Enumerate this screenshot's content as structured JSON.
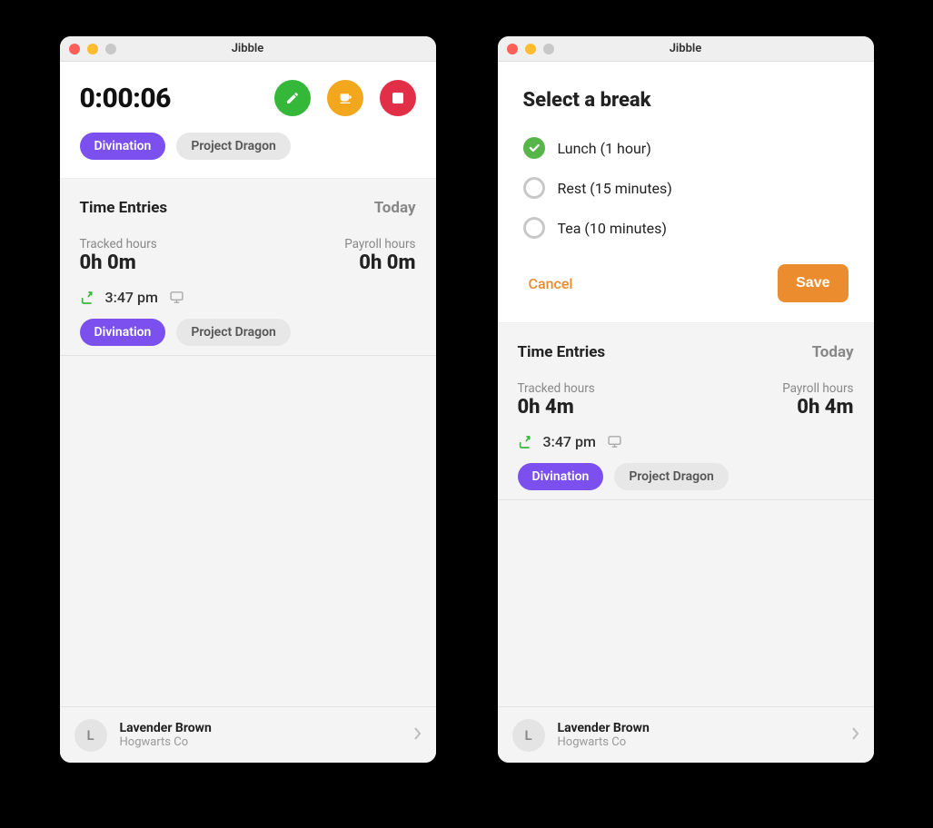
{
  "app_title": "Jibble",
  "colors": {
    "purple": "#7b50ef",
    "green": "#35b83a",
    "orange_circle": "#f2a71c",
    "red": "#e12f47",
    "save_orange": "#eb8d2f",
    "radio_green": "#58b54a"
  },
  "window_left": {
    "timer": "0:00:06",
    "tags": {
      "primary": "Divination",
      "secondary": "Project Dragon"
    },
    "entries": {
      "title": "Time Entries",
      "day": "Today",
      "tracked_label": "Tracked hours",
      "tracked_value": "0h 0m",
      "payroll_label": "Payroll hours",
      "payroll_value": "0h 0m",
      "time": "3:47 pm",
      "tag_primary": "Divination",
      "tag_secondary": "Project Dragon"
    },
    "user": {
      "initial": "L",
      "name": "Lavender Brown",
      "company": "Hogwarts Co"
    }
  },
  "window_right": {
    "break": {
      "title": "Select a break",
      "options": [
        {
          "label": "Lunch (1 hour)",
          "selected": true
        },
        {
          "label": "Rest (15 minutes)",
          "selected": false
        },
        {
          "label": "Tea (10 minutes)",
          "selected": false
        }
      ],
      "cancel": "Cancel",
      "save": "Save"
    },
    "entries": {
      "title": "Time Entries",
      "day": "Today",
      "tracked_label": "Tracked hours",
      "tracked_value": "0h 4m",
      "payroll_label": "Payroll hours",
      "payroll_value": "0h 4m",
      "time": "3:47 pm",
      "tag_primary": "Divination",
      "tag_secondary": "Project Dragon"
    },
    "user": {
      "initial": "L",
      "name": "Lavender Brown",
      "company": "Hogwarts Co"
    }
  }
}
